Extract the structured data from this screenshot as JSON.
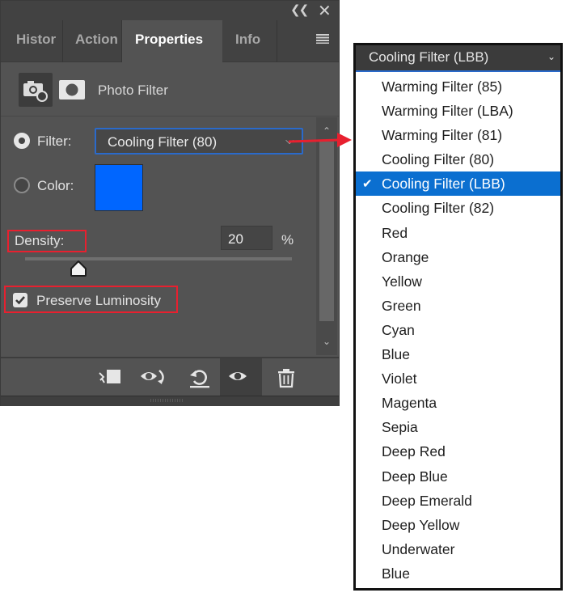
{
  "panel": {
    "titlebar": {
      "collapse_icon": "double-chevron-left",
      "close_icon": "x-close"
    },
    "tabs": [
      {
        "label": "Histor",
        "active": false
      },
      {
        "label": "Action",
        "active": false
      },
      {
        "label": "Properties",
        "active": true
      },
      {
        "label": "Info",
        "active": false
      }
    ],
    "menu_icon": "hamburger-menu",
    "adjustment": {
      "icon": "camera-adjustment-icon",
      "mask_icon": "layer-mask-icon",
      "title": "Photo Filter"
    },
    "filter": {
      "radio_selected": true,
      "label": "Filter:",
      "value": "Cooling Filter (80)"
    },
    "color": {
      "radio_selected": false,
      "label": "Color:",
      "swatch": "#0066ff"
    },
    "density": {
      "label": "Density:",
      "value": "20",
      "unit": "%",
      "slider_percent": 20
    },
    "preserve_luminosity": {
      "label": "Preserve Luminosity",
      "checked": true
    },
    "footer_icons": [
      "clip-to-layer-icon",
      "view-previous-state-icon",
      "reset-icon",
      "toggle-visibility-icon",
      "delete-icon"
    ]
  },
  "annotation": {
    "highlight_color": "#e8202f",
    "arrow_color": "#e8202f"
  },
  "dropdown": {
    "current": "Cooling Filter (LBB)",
    "selected_index": 4,
    "options": [
      "Warming Filter (85)",
      "Warming Filter (LBA)",
      "Warming Filter (81)",
      "Cooling Filter (80)",
      "Cooling Filter (LBB)",
      "Cooling Filter (82)",
      "Red",
      "Orange",
      "Yellow",
      "Green",
      "Cyan",
      "Blue",
      "Violet",
      "Magenta",
      "Sepia",
      "Deep Red",
      "Deep Blue",
      "Deep Emerald",
      "Deep Yellow",
      "Underwater",
      "Blue"
    ],
    "selected_color": "#0b6fd0"
  }
}
